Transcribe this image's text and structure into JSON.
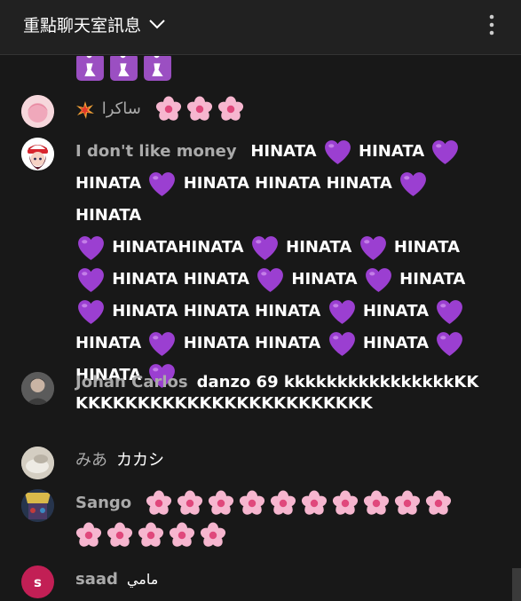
{
  "header": {
    "title": "重點聊天室訊息",
    "chevron_icon": "chevron-down-icon",
    "menu_icon": "more-vert-icon"
  },
  "colors": {
    "background": "#181818",
    "header_bg": "#212121",
    "author": "#aaaaaa",
    "heart": "#9b3fd1",
    "blossom": "#f6b6cf",
    "saad_avatar": "#c21f55"
  },
  "messages": [
    {
      "id": "m0",
      "author": "",
      "text": "",
      "emoji_row": [
        "pray",
        "pray",
        "pray"
      ]
    },
    {
      "id": "m1",
      "author": "ساكرا",
      "badge": "collision-icon",
      "emoji_row": [
        "blossom",
        "blossom",
        "blossom"
      ]
    },
    {
      "id": "m2",
      "author": "I don't like money",
      "lines": [
        [
          "HINATA",
          "heart",
          "HINATA",
          "heart"
        ],
        [
          "HINATA",
          "heart",
          "HINATA HINATA HINATA",
          "heart",
          "HINATA"
        ],
        [
          "heart",
          "HINATAHINATA",
          "heart",
          "HINATA",
          "heart",
          "HINATA"
        ],
        [
          "heart",
          "HINATA HINATA",
          "heart",
          "HINATA",
          "heart",
          "HINATA"
        ],
        [
          "heart",
          "HINATA HINATA HINATA",
          "heart",
          "HINATA",
          "heart"
        ],
        [
          "HINATA",
          "heart",
          "HINATA HINATA",
          "heart",
          "HINATA",
          "heart"
        ],
        [
          "HINATA",
          "heart"
        ]
      ]
    },
    {
      "id": "m3",
      "author": "Johan Carlos",
      "text": "danzo 69 kkkkkkkkkkkkkkkkKKKKKKKKKKKKKKKKKKKKKKKKKK"
    },
    {
      "id": "m4",
      "author": "みあ",
      "text": "カカシ"
    },
    {
      "id": "m5",
      "author": "Sango",
      "blossom_count": 15
    },
    {
      "id": "m6",
      "author": "saad",
      "text": "مامي",
      "avatar_letter": "s"
    }
  ]
}
